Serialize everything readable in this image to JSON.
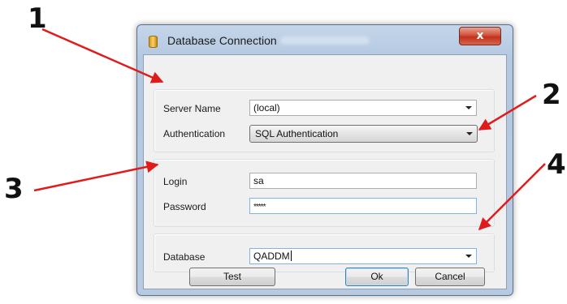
{
  "callouts": [
    "1",
    "2",
    "3",
    "4"
  ],
  "window": {
    "title": "Database Connection",
    "close_glyph": "x"
  },
  "server": {
    "server_name_label": "Server Name",
    "server_name_value": "(local)",
    "authentication_label": "Authentication",
    "authentication_value": "SQL Authentication"
  },
  "credentials": {
    "login_label": "Login",
    "login_value": "sa",
    "password_label": "Password",
    "password_value": "*****"
  },
  "database": {
    "label": "Database",
    "value": "QADDM"
  },
  "buttons": {
    "test": "Test",
    "ok": "Ok",
    "cancel": "Cancel"
  },
  "colors": {
    "arrow": "#e01b1b",
    "title_bar": "#b9cde4",
    "close_button": "#c8402a"
  }
}
